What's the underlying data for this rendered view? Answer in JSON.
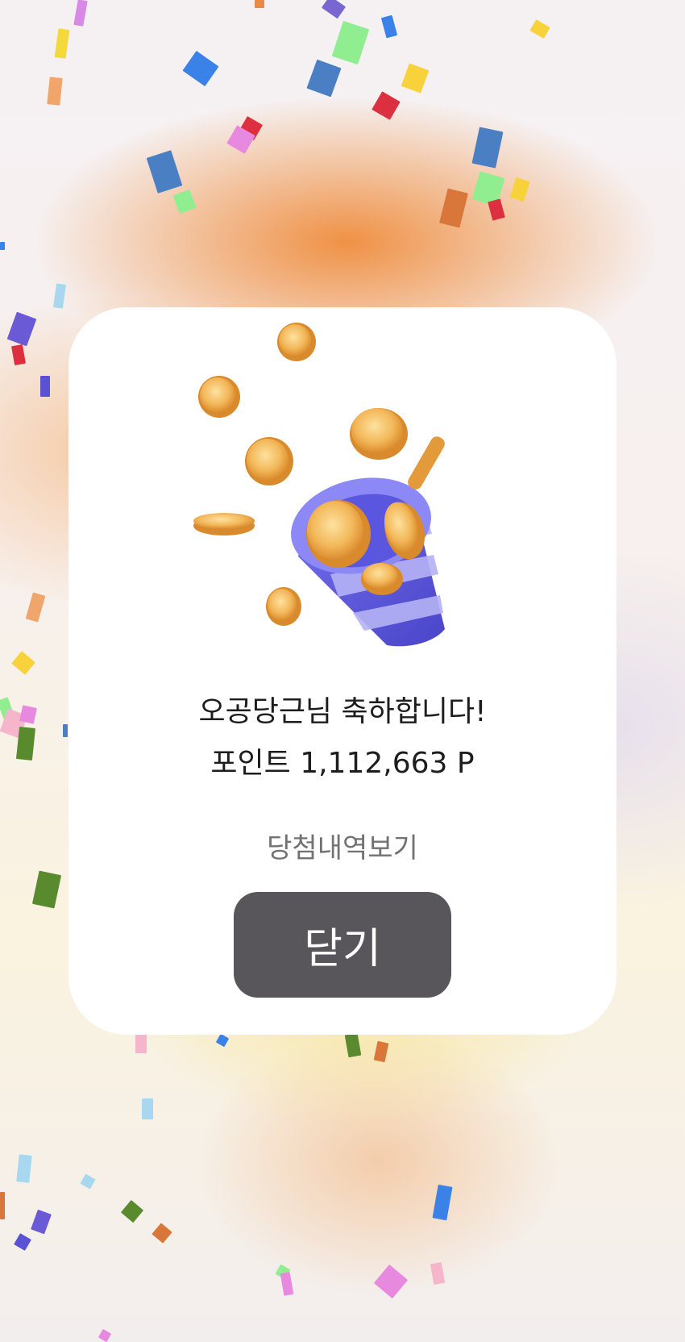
{
  "popup": {
    "title": "오공당근님 축하합니다!",
    "points": "포인트 1,112,663 P",
    "history_link": "당첨내역보기",
    "close_label": "닫기"
  },
  "illustration": {
    "icon": "party-popper-with-coins",
    "popper_color": "#5b56e0",
    "coin_color": "#f3b85a"
  },
  "colors": {
    "button_bg": "#58565a",
    "background_accent": "#ef8c3c"
  }
}
